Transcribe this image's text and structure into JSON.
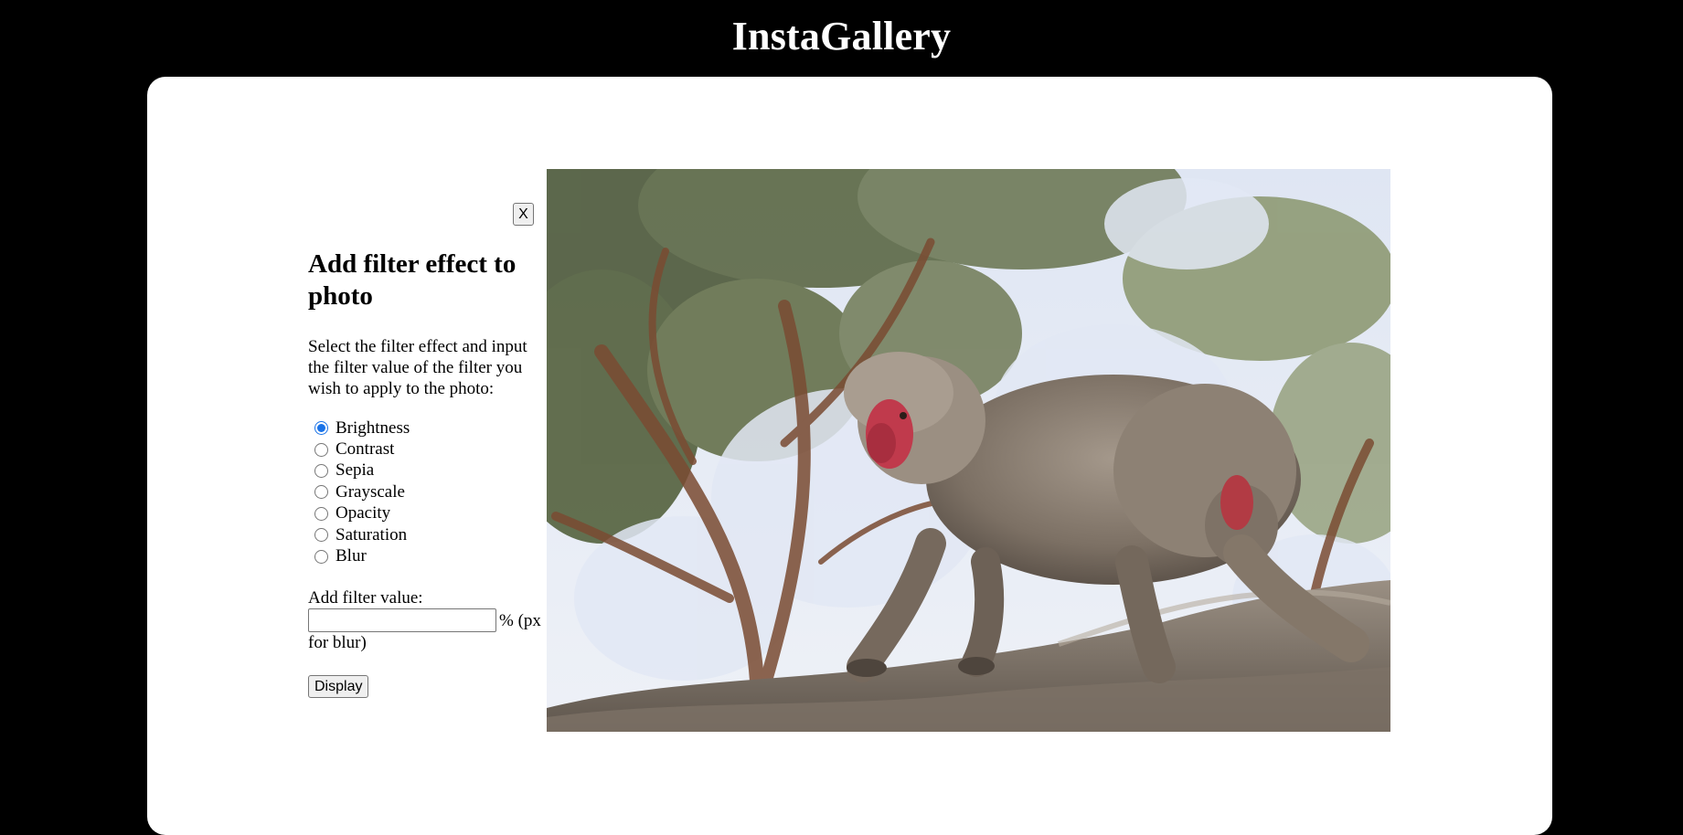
{
  "header": {
    "title": "InstaGallery"
  },
  "filter_dialog": {
    "close_label": "X",
    "heading": "Add filter effect to photo",
    "description": "Select the filter effect and input the filter value of the filter you wish to apply to the photo:",
    "filters": [
      {
        "label": "Brightness",
        "selected": true
      },
      {
        "label": "Contrast",
        "selected": false
      },
      {
        "label": "Sepia",
        "selected": false
      },
      {
        "label": "Grayscale",
        "selected": false
      },
      {
        "label": "Opacity",
        "selected": false
      },
      {
        "label": "Saturation",
        "selected": false
      },
      {
        "label": "Blur",
        "selected": false
      }
    ],
    "value_label": "Add filter value:",
    "value_input": "",
    "unit_text_line1": "% (px",
    "unit_text_line2": "for blur)",
    "display_label": "Display"
  },
  "photo": {
    "subject": "monkey-walking-on-rock"
  },
  "colors": {
    "page_background": "#000000",
    "panel_background": "#ffffff",
    "title_color": "#ffffff",
    "radio_accent": "#1a73e8"
  }
}
